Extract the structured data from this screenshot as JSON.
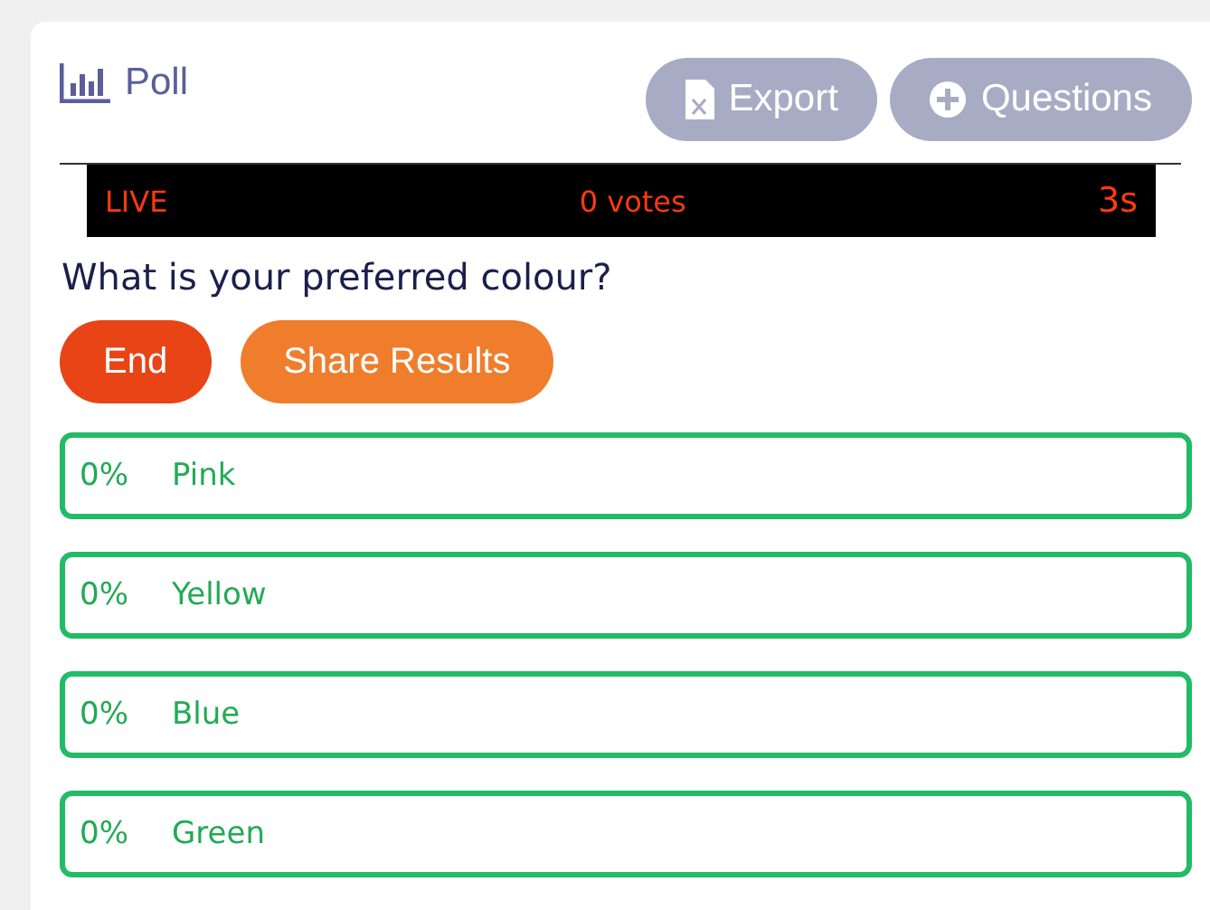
{
  "header": {
    "title": "Poll",
    "buttons": [
      {
        "kind": "export",
        "label": "Export"
      },
      {
        "kind": "add",
        "label": "Questions"
      }
    ]
  },
  "status_bar": {
    "state": "LIVE",
    "votes": "0 votes",
    "timer": "3s"
  },
  "question": "What is your preferred colour?",
  "actions": [
    {
      "kind": "danger",
      "label": "End"
    },
    {
      "kind": "warning",
      "label": "Share Results"
    }
  ],
  "options": [
    {
      "percent": "0%",
      "label": "Pink"
    },
    {
      "percent": "0%",
      "label": "Yellow"
    },
    {
      "percent": "0%",
      "label": "Blue"
    },
    {
      "percent": "0%",
      "label": "Green"
    }
  ]
}
